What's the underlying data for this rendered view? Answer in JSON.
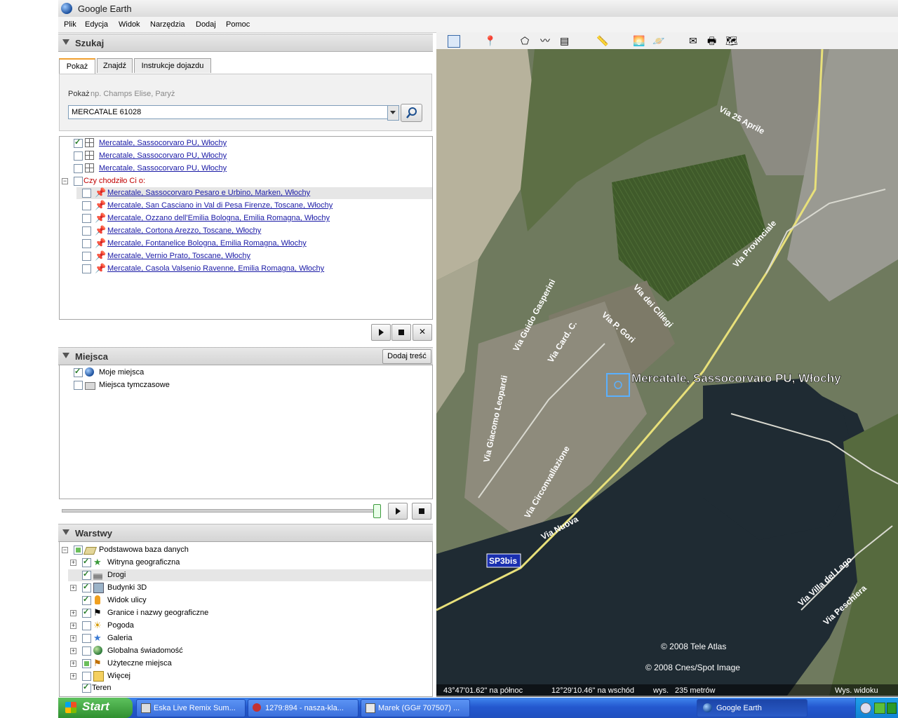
{
  "window": {
    "title": "Google Earth"
  },
  "menu": [
    "Plik",
    "Edycja",
    "Widok",
    "Narzędzia",
    "Dodaj",
    "Pomoc"
  ],
  "search_panel": {
    "title": "Szukaj",
    "tabs": [
      "Pokaż",
      "Znajdź",
      "Instrukcje dojazdu"
    ],
    "hint_label": "Pokaż",
    "hint_example": "np. Champs Elise, Paryż",
    "input_value": "MERCATALE 61028",
    "results": [
      {
        "label": "Mercatale, Sassocorvaro PU, Włochy",
        "checked": true
      },
      {
        "label": "Mercatale, Sassocorvaro PU, Włochy",
        "checked": false
      },
      {
        "label": "Mercatale, Sassocorvaro PU, Włochy",
        "checked": false
      }
    ],
    "did_you_mean": "Czy chodziło Ci o:",
    "suggestions": [
      "Mercatale, Sassocorvaro Pesaro e Urbino, Marken, Włochy",
      "Mercatale, San Casciano in Val di Pesa Firenze, Toscane, Włochy",
      "Mercatale, Ozzano dell'Emilia Bologna, Emilia Romagna, Włochy",
      "Mercatale, Cortona Arezzo, Toscane, Włochy",
      "Mercatale, Fontanelice Bologna, Emilia Romagna, Włochy",
      "Mercatale, Vernio Prato, Toscane, Włochy",
      "Mercatale, Casola Valsenio Ravenne, Emilia Romagna, Włochy"
    ]
  },
  "places_panel": {
    "title": "Miejsca",
    "add_button": "Dodaj treść",
    "items": [
      {
        "label": "Moje miejsca",
        "checked": true
      },
      {
        "label": "Miejsca tymczasowe",
        "checked": false
      }
    ]
  },
  "layers_panel": {
    "title": "Warstwy",
    "root": "Podstawowa baza danych",
    "items": [
      {
        "label": "Witryna geograficzna",
        "checked": true
      },
      {
        "label": "Drogi",
        "checked": true
      },
      {
        "label": "Budynki 3D",
        "checked": true
      },
      {
        "label": "Widok ulicy",
        "checked": true
      },
      {
        "label": "Granice i nazwy geograficzne",
        "checked": true
      },
      {
        "label": "Pogoda",
        "checked": false
      },
      {
        "label": "Galeria",
        "checked": false
      },
      {
        "label": "Globalna świadomość",
        "checked": false
      },
      {
        "label": "Użyteczne miejsca",
        "checked": "partial"
      },
      {
        "label": "Więcej",
        "checked": false
      },
      {
        "label": "Teren",
        "checked": true
      }
    ]
  },
  "map": {
    "place_label": "Mercatale, Sassocorvaro PU, Włochy",
    "roads": [
      "Via 25 Aprile",
      "Via Provinciale",
      "Via dei Ciliegi",
      "Via Guido Gasperini",
      "Via P. Gori",
      "Via Card. C.",
      "Via Giacomo Leopardi",
      "Via Circonvallazione",
      "Via Nuova",
      "Via Villa del Lago",
      "Via Peschiera"
    ],
    "shield": "SP3bis",
    "credit_1": "© 2008 Tele Atlas",
    "credit_2": "© 2008 Cnes/Spot Image",
    "status": {
      "lat": "43°47'01.62\" na północ",
      "lon": "12°29'10.46\" na wschód",
      "elev_label": "wys.",
      "elev_value": "235 metrów",
      "eye_alt": "Wys. widoku"
    }
  },
  "taskbar": {
    "start": "Start",
    "tasks": [
      "Eska Live Remix Sum...",
      "1279:894 - nasza-kla...",
      "Marek (GG# 707507) ...",
      "Google Earth"
    ]
  },
  "colors": {
    "link": "#1a1aa6",
    "did_you_mean": "#c00000",
    "taskbar": "#2458cf",
    "water": "#1f2b33"
  }
}
